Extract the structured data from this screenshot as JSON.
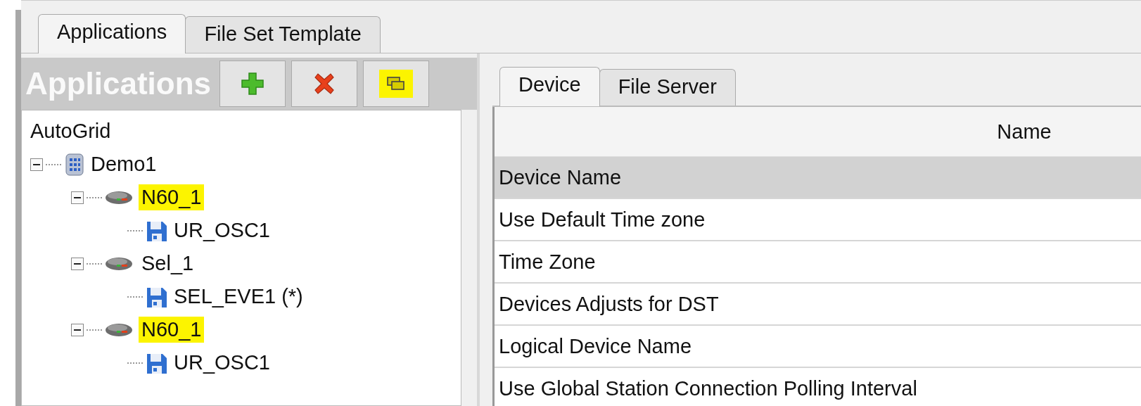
{
  "main_tabs": [
    {
      "label": "Applications",
      "selected": true
    },
    {
      "label": "File Set Template",
      "selected": false
    }
  ],
  "applications_panel": {
    "title": "Applications",
    "buttons": [
      {
        "kind": "add",
        "highlighted": false
      },
      {
        "kind": "delete",
        "highlighted": false
      },
      {
        "kind": "copy",
        "highlighted": true
      }
    ]
  },
  "tree": {
    "root": "AutoGrid",
    "items": [
      {
        "label": "Demo1",
        "kind": "database",
        "expanded": true,
        "highlighted": false,
        "children": [
          {
            "label": "N60_1",
            "kind": "device",
            "expanded": true,
            "highlighted": true,
            "children": [
              {
                "label": "UR_OSC1",
                "kind": "file",
                "highlighted": false
              }
            ]
          },
          {
            "label": "Sel_1",
            "kind": "device",
            "expanded": true,
            "highlighted": false,
            "children": [
              {
                "label": "SEL_EVE1 (*)",
                "kind": "file",
                "highlighted": false
              }
            ]
          },
          {
            "label": "N60_1",
            "kind": "device",
            "expanded": true,
            "highlighted": true,
            "children": [
              {
                "label": "UR_OSC1",
                "kind": "file",
                "highlighted": false
              }
            ]
          }
        ]
      }
    ]
  },
  "detail_tabs": [
    {
      "label": "Device",
      "selected": true
    },
    {
      "label": "File Server",
      "selected": false
    }
  ],
  "table": {
    "columns": [
      "Name"
    ],
    "rows": [
      {
        "name": "Device Name",
        "selected": true
      },
      {
        "name": "Use Default Time zone",
        "selected": false
      },
      {
        "name": "Time Zone",
        "selected": false
      },
      {
        "name": "Devices Adjusts for DST",
        "selected": false
      },
      {
        "name": "Logical Device Name",
        "selected": false
      },
      {
        "name": "Use Global Station Connection Polling Interval",
        "selected": false
      }
    ]
  }
}
